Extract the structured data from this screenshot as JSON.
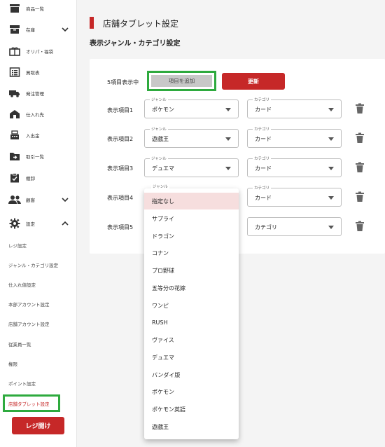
{
  "sidebar": {
    "items": [
      {
        "label": "商品一覧",
        "icon": "product-list-icon"
      },
      {
        "label": "在庫",
        "icon": "inventory-icon"
      },
      {
        "label": "オリパ・福袋",
        "icon": "gift-bag-icon"
      },
      {
        "label": "買取表",
        "icon": "purchase-table-icon"
      },
      {
        "label": "発注管理",
        "icon": "truck-icon"
      },
      {
        "label": "仕入れ先",
        "icon": "factory-icon"
      },
      {
        "label": "入出金",
        "icon": "register-icon"
      },
      {
        "label": "取引一覧",
        "icon": "folder-arrow-icon"
      },
      {
        "label": "棚卸",
        "icon": "clipboard-check-icon"
      },
      {
        "label": "顧客",
        "icon": "people-icon"
      },
      {
        "label": "設定",
        "icon": "gear-icon"
      }
    ],
    "settings_sub": [
      "レジ設定",
      "ジャンル・カテゴリ設定",
      "仕入れ値設定",
      "本部アカウント設定",
      "店舗アカウント設定",
      "従業員一覧",
      "権限",
      "ポイント設定",
      "店舗タブレット設定"
    ],
    "active_item": "店舗タブレット設定",
    "register_open_label": "レジ開け"
  },
  "page": {
    "title": "店舗タブレット設定",
    "section_title": "表示ジャンル・カテゴリ設定"
  },
  "controls": {
    "count_label": "5項目表示中",
    "add_label": "項目を追加",
    "update_label": "更新"
  },
  "rows": [
    {
      "label": "表示項目1",
      "genre_legend": "ジャンル",
      "genre": "ポケモン",
      "category_legend": "カテゴリ",
      "category": "カード"
    },
    {
      "label": "表示項目2",
      "genre_legend": "ジャンル",
      "genre": "遊戯王",
      "category_legend": "カテゴリ",
      "category": "カード"
    },
    {
      "label": "表示項目3",
      "genre_legend": "ジャンル",
      "genre": "デュエマ",
      "category_legend": "カテゴリ",
      "category": "カード"
    },
    {
      "label": "表示項目4",
      "genre_legend": "ジャンル",
      "genre": "",
      "category_legend": "カテゴリ",
      "category": "カード"
    },
    {
      "label": "表示項目5",
      "genre_legend": "",
      "genre": "",
      "category_legend": "",
      "category": "カテゴリ"
    }
  ],
  "dropdown": {
    "legend": "ジャンル",
    "options": [
      "指定なし",
      "サプライ",
      "ドラゴン",
      "コナン",
      "プロ野球",
      "五等分の花嫁",
      "ワンピ",
      "RUSH",
      "ヴァイス",
      "デュエマ",
      "バンダイ版",
      "ポケモン",
      "ポケモン英語",
      "遊戯王"
    ],
    "selected": "指定なし"
  },
  "colors": {
    "accent": "#c62828",
    "highlight": "#2eaa3e",
    "selected_option_bg": "#f6dede"
  }
}
